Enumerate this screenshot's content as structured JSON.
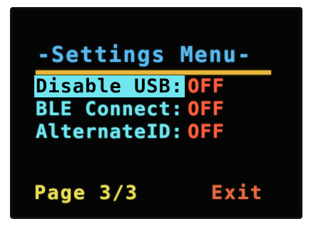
{
  "menu": {
    "title": "-Settings Menu-",
    "items": [
      {
        "label": "Disable USB:",
        "value": "OFF",
        "selected": true
      },
      {
        "label": "BLE Connect:",
        "value": "OFF",
        "selected": false
      },
      {
        "label": "AlternateID:",
        "value": "OFF",
        "selected": false
      }
    ]
  },
  "footer": {
    "page_label": "Page 3/3",
    "exit_label": "Exit"
  },
  "colors": {
    "title": "#57b8ef",
    "divider": "#e7b53a",
    "label": "#6fe6ef",
    "value_off": "#ff5d3c",
    "page": "#e9dd55",
    "exit": "#e66a3f",
    "background": "#050505"
  }
}
